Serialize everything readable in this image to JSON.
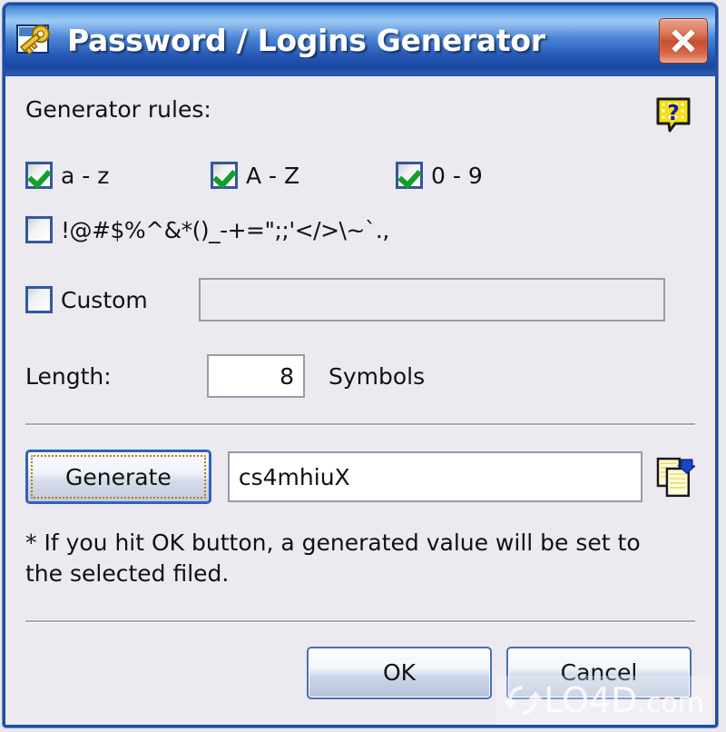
{
  "window": {
    "title": "Password / Logins Generator",
    "app_icon": "key-icon",
    "close_label": "Close",
    "title_bar_color": "#2558b4",
    "close_button_color": "#c8502f",
    "body_background": "#ece9f0"
  },
  "rules": {
    "label": "Generator rules:",
    "help_icon": "help-question-icon",
    "checkboxes": [
      {
        "label": "a - z",
        "checked": true
      },
      {
        "label": "A - Z",
        "checked": true
      },
      {
        "label": "0 - 9",
        "checked": true
      }
    ],
    "symbols": {
      "label": "!@#$%^&*()_-+=\";;'</>\\~`.,",
      "checked": false
    },
    "custom": {
      "label": "Custom",
      "checked": false,
      "value": "",
      "placeholder": ""
    }
  },
  "length": {
    "label": "Length:",
    "value": "8",
    "unit": "Symbols"
  },
  "generate": {
    "button_label": "Generate",
    "result_value": "cs4mhiuX",
    "copy_icon": "copy-to-clipboard-icon"
  },
  "note": {
    "text": "* If you hit OK button, a generated value will be set to the selected filed."
  },
  "footer": {
    "ok_label": "OK",
    "cancel_label": "Cancel"
  },
  "watermark": {
    "text": "LO4D",
    "suffix": ".com",
    "logo_icon": "refresh-circle-icon"
  }
}
